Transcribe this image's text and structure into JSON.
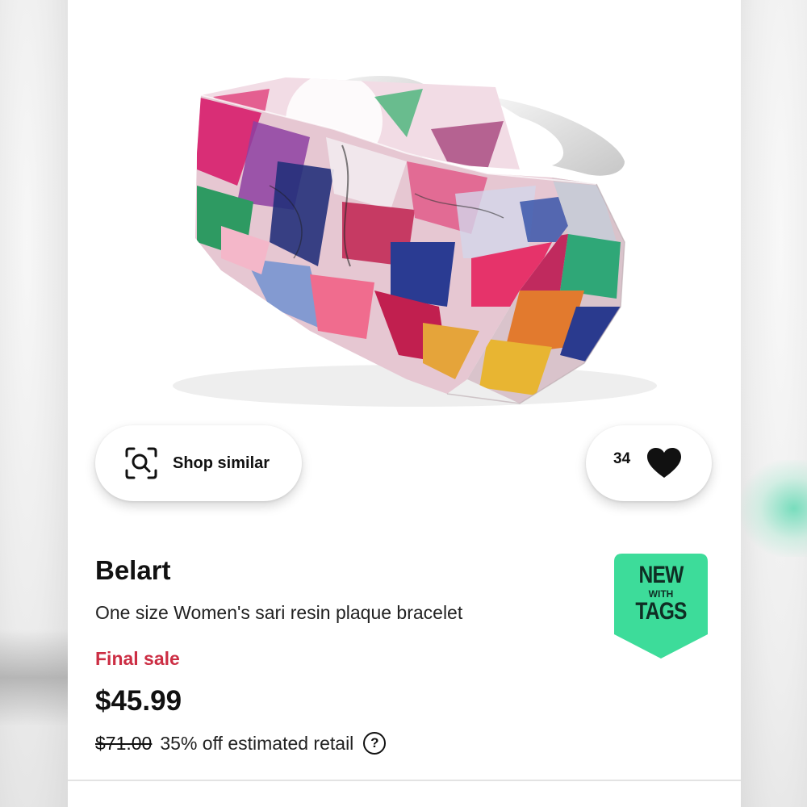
{
  "listing": {
    "image_alt": "Multicolor sari resin plaque cuff bracelet",
    "actions": {
      "shop_similar_label": "Shop similar",
      "like_count": "34"
    },
    "brand": "Belart",
    "title": "One size Women's sari resin plaque bracelet",
    "sale_flag": "Final sale",
    "price": "$45.99",
    "original_retail": "$71.00",
    "discount_text": "35% off estimated retail",
    "help_symbol": "?",
    "badge": {
      "line1": "NEW",
      "line2": "WITH",
      "line3": "TAGS",
      "color": "#3ddc9a"
    }
  },
  "colors": {
    "sale_red": "#cc2e44",
    "text_primary": "#111111"
  },
  "icons": {
    "shop_similar": "scan-search-icon",
    "like": "heart-icon",
    "help": "question-circle-icon"
  }
}
